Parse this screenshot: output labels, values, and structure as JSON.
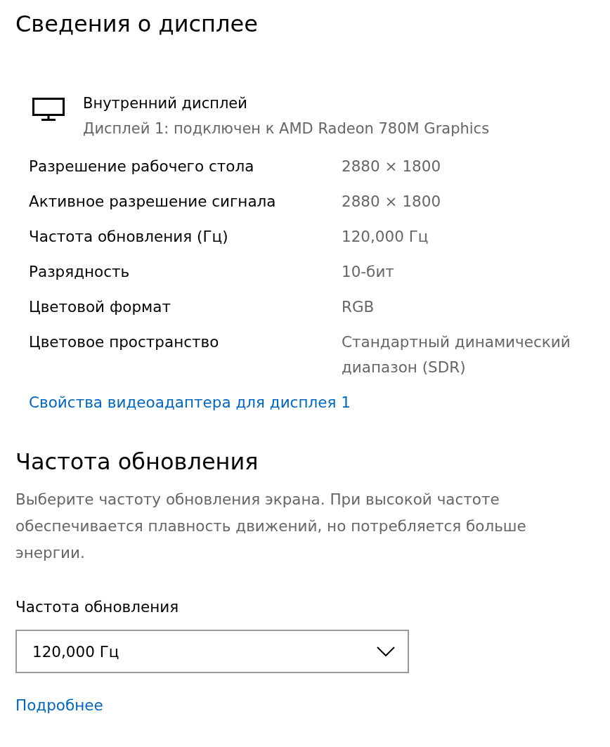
{
  "title": "Сведения о дисплее",
  "display": {
    "name": "Внутренний дисплей",
    "subtitle": "Дисплей 1: подключен к AMD Radeon 780M Graphics"
  },
  "properties": [
    {
      "label": "Разрешение рабочего стола",
      "value": "2880 × 1800"
    },
    {
      "label": "Активное разрешение сигнала",
      "value": "2880 × 1800"
    },
    {
      "label": "Частота обновления (Гц)",
      "value": "120,000 Гц"
    },
    {
      "label": "Разрядность",
      "value": "10-бит"
    },
    {
      "label": "Цветовой формат",
      "value": "RGB"
    },
    {
      "label": "Цветовое пространство",
      "value": "Стандартный динамический диапазон (SDR)"
    }
  ],
  "adapter_link": "Свойства видеоадаптера для дисплея 1",
  "refresh": {
    "heading": "Частота обновления",
    "description": "Выберите частоту обновления экрана. При высокой частоте обеспечивается плавность движений, но потребляется больше энергии.",
    "field_label": "Частота обновления",
    "value": "120,000 Гц",
    "link": "Подробнее"
  }
}
